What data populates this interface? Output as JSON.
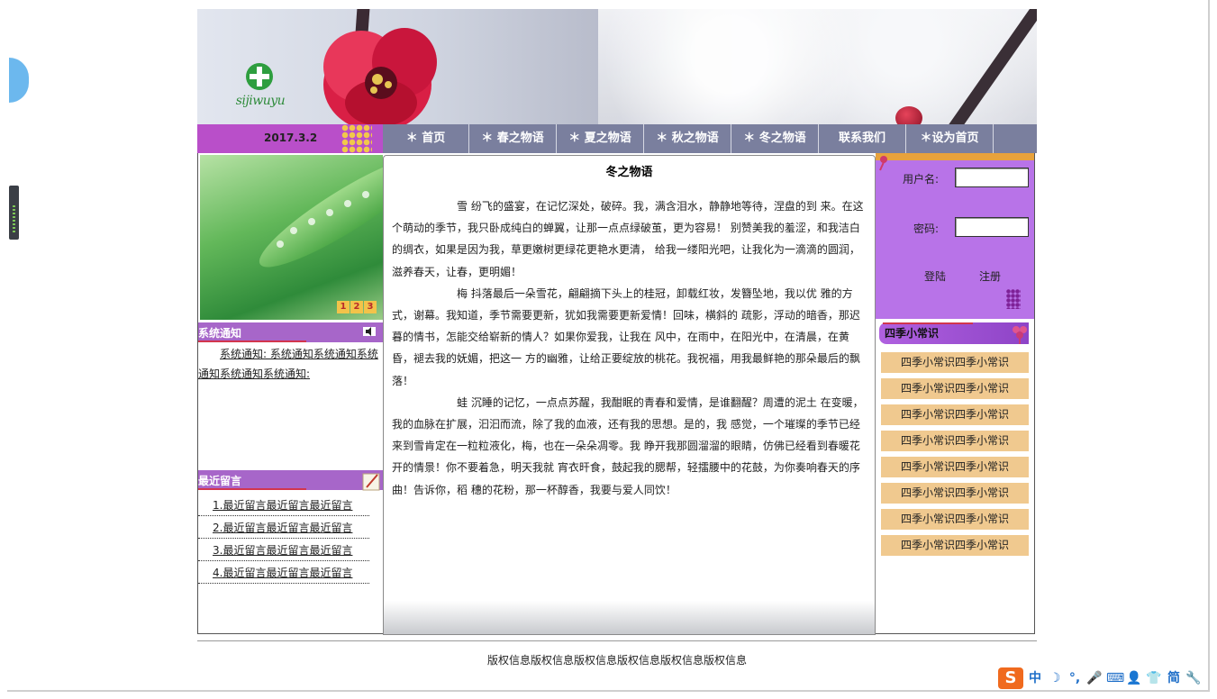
{
  "header": {
    "logo_text": "sijiwuyu",
    "date": "2017.3.2"
  },
  "nav": {
    "items": [
      {
        "label": "＊ 首页"
      },
      {
        "label": "＊ 春之物语"
      },
      {
        "label": "＊ 夏之物语"
      },
      {
        "label": "＊ 秋之物语"
      },
      {
        "label": "＊ 冬之物语"
      },
      {
        "label": "联系我们"
      },
      {
        "label": "＊设为首页"
      }
    ]
  },
  "slideshow": {
    "numbers": [
      "1",
      "2",
      "3"
    ]
  },
  "notice": {
    "title": "系统通知",
    "text": "系统通知: 系统通知系统通知系统通知系统通知系统通知:"
  },
  "messages": {
    "title": "最近留言",
    "items": [
      "1.最近留言最近留言最近留言",
      "2.最近留言最近留言最近留言",
      "3.最近留言最近留言最近留言",
      "4.最近留言最近留言最近留言"
    ]
  },
  "article": {
    "title": "冬之物语",
    "paragraphs": [
      "雪 纷飞的盛宴，在记忆深处，破碎。我，满含泪水，静静地等待，涅盘的到 来。在这个萌动的季节，我只卧成纯白的蝉翼，让那一点点绿破茧，更为容易！ 别赞美我的羞涩，和我洁白的绸衣，如果是因为我，草更嫩树更绿花更艳水更清， 给我一缕阳光吧，让我化为一滴滴的圆润，滋养春天，让春，更明媚！",
      "梅 抖落最后一朵雪花，翩翩摘下头上的桂冠，卸载红妆，发簪坠地，我以优 雅的方式，谢幕。我知道，季节需要更新，犹如我需要更新爱情！回味，横斜的 疏影，浮动的暗香，那迟暮的情书，怎能交给崭新的情人？如果你爱我，让我在 风中，在雨中，在阳光中，在清晨，在黄昏，褪去我的妩媚，把这一 方的幽雅，让给正要绽放的桃花。我祝福，用我最鲜艳的那朵最后的飘落！",
      "蛙 沉睡的记忆，一点点苏醒，我酣眠的青春和爱情，是谁翻醒？周遭的泥土 在变暖，我的血脉在扩展，汩汩而流，除了我的血液，还有我的思想。是的，我 感觉，一个璀璨的季节已经来到雪肯定在一粒粒液化，梅，也在一朵朵凋零。我 睁开我那圆溜溜的眼睛，仿佛已经看到春暖花开的情景！你不要着急，明天我就 宵衣旰食，鼓起我的腮帮，轻擂腰中的花鼓，为你奏响春天的序曲！告诉你，稻 穗的花粉，那一杯醇香，我要与爱人同饮！"
    ]
  },
  "login": {
    "username_label": "用户名:",
    "username_value": "",
    "password_label": "密码:",
    "password_value": "",
    "login_button": "登陆",
    "register_button": "注册"
  },
  "tips": {
    "title": "四季小常识",
    "items": [
      "四季小常识四季小常识",
      "四季小常识四季小常识",
      "四季小常识四季小常识",
      "四季小常识四季小常识",
      "四季小常识四季小常识",
      "四季小常识四季小常识",
      "四季小常识四季小常识",
      "四季小常识四季小常识"
    ]
  },
  "footer": {
    "text": "版权信息版权信息版权信息版权信息版权信息版权信息"
  },
  "ime": {
    "logo": "S",
    "items": [
      "中",
      "☽",
      "°,",
      "🎤",
      "⌨",
      "👤",
      "👕",
      "简",
      "🔧"
    ]
  },
  "colors": {
    "nav_bg": "#7a7f9e",
    "date_bg": "#b94fc9",
    "login_bg": "#b873e8",
    "panel_head": "#a766c9",
    "tip_bg": "#f0c98f"
  }
}
